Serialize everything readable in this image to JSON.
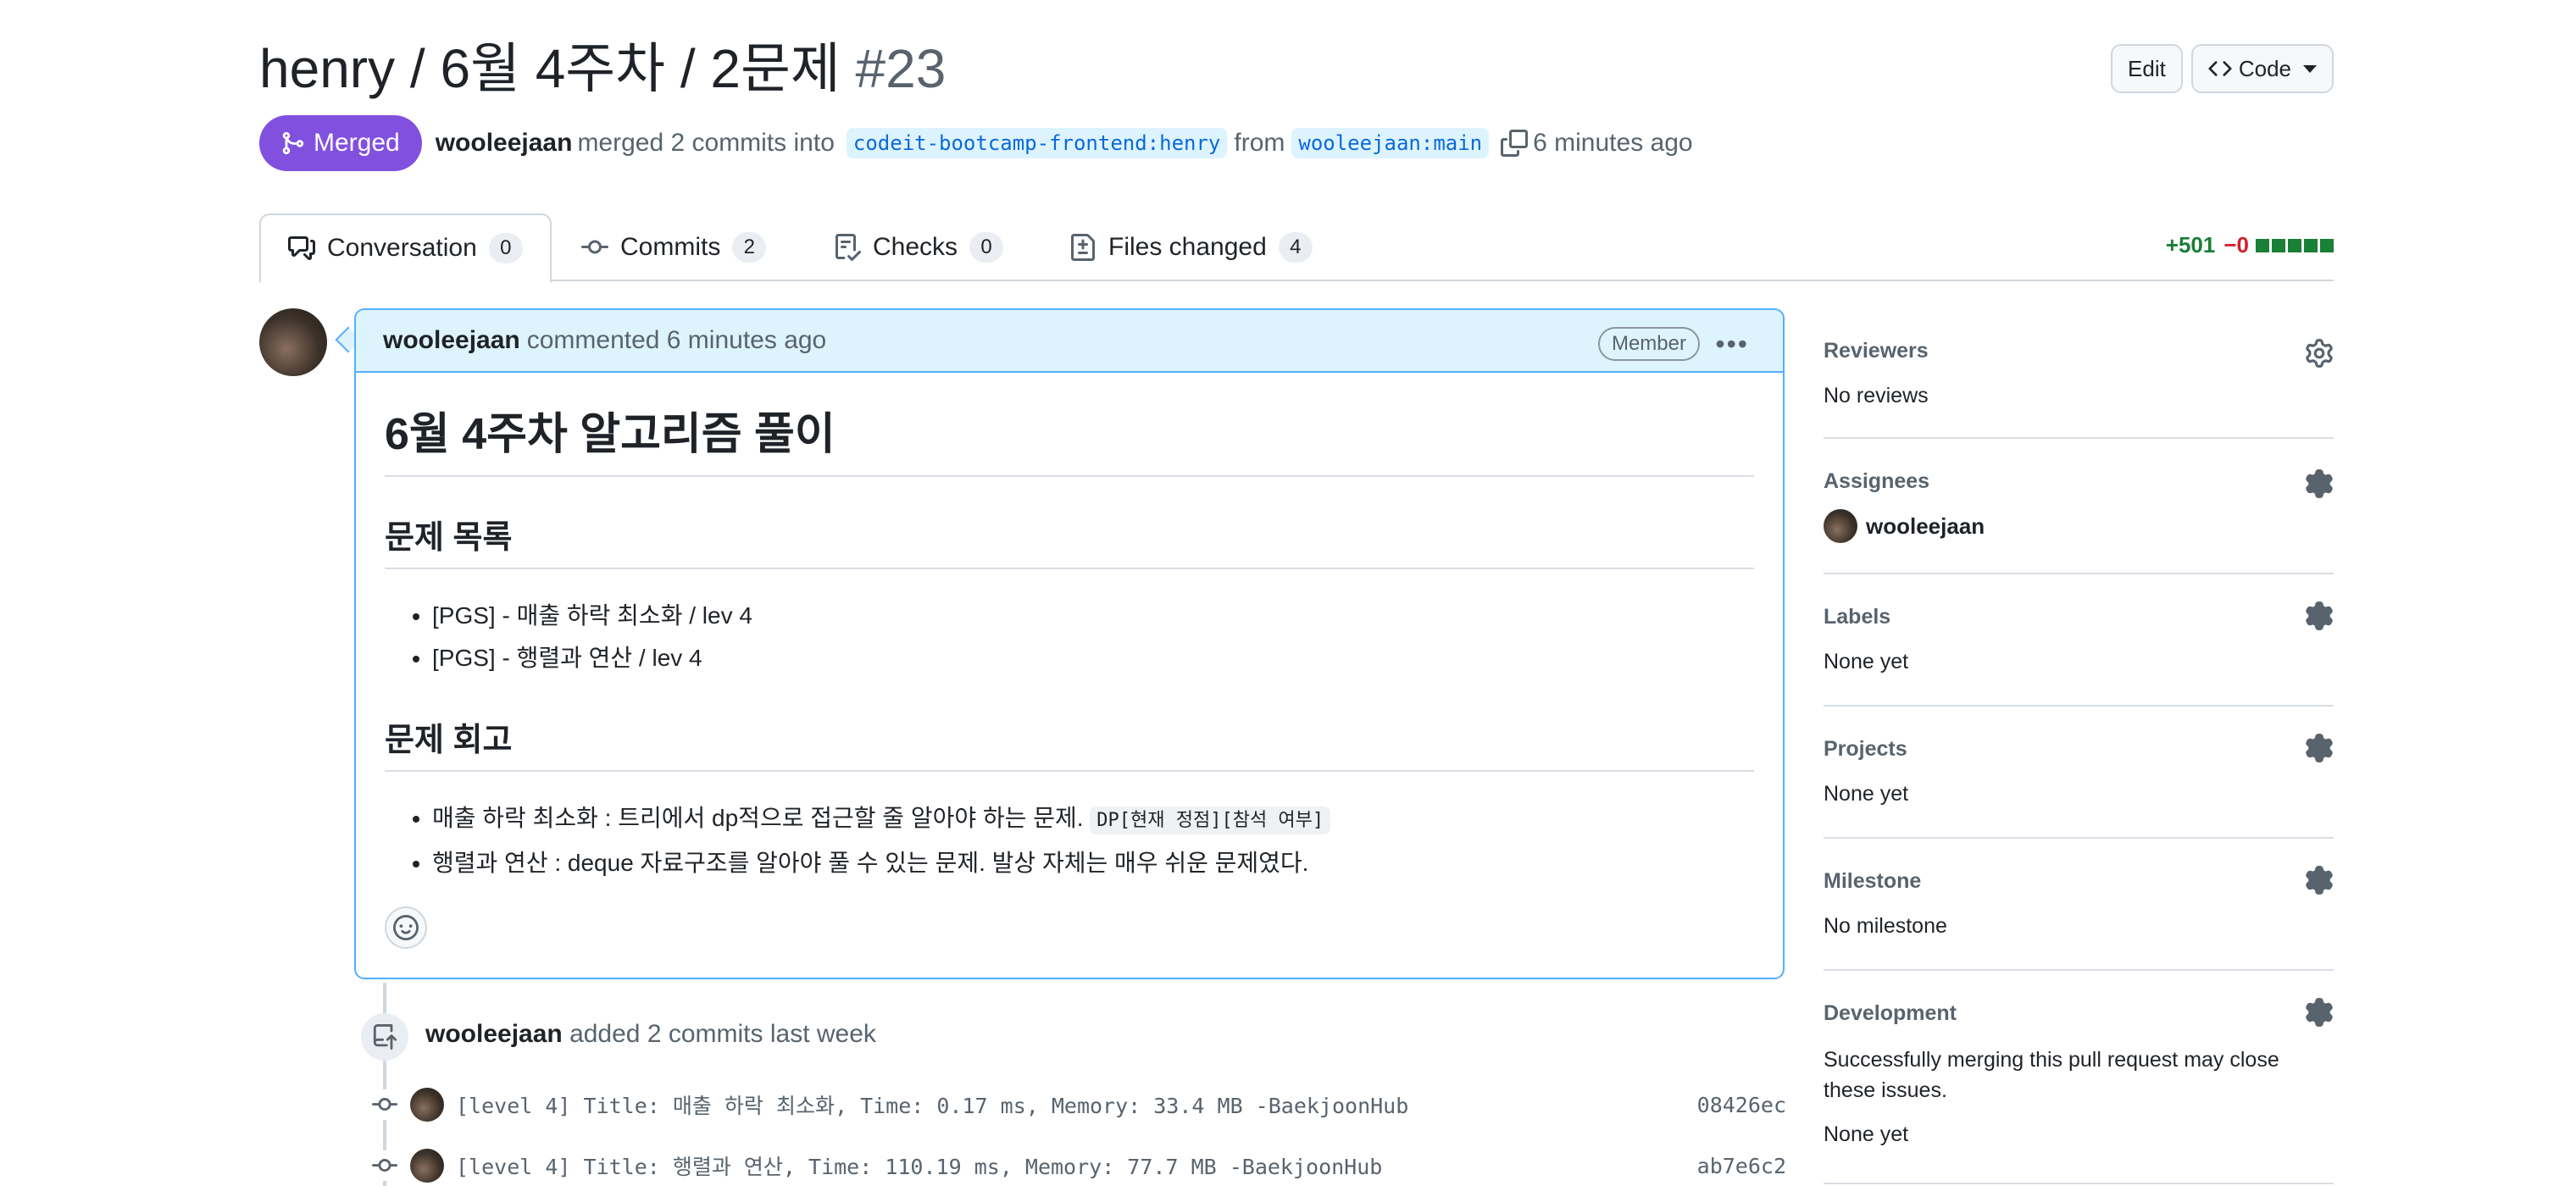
{
  "header": {
    "title": "henry / 6월 4주차 / 2문제",
    "number": "#23",
    "edit_label": "Edit",
    "code_label": "Code"
  },
  "meta": {
    "state": "Merged",
    "author": "wooleejaan",
    "action": "merged 2 commits into",
    "base_branch": "codeit-bootcamp-frontend:henry",
    "from": "from",
    "head_branch": "wooleejaan:main",
    "time": "6 minutes ago"
  },
  "tabs": [
    {
      "label": "Conversation",
      "count": "0"
    },
    {
      "label": "Commits",
      "count": "2"
    },
    {
      "label": "Checks",
      "count": "0"
    },
    {
      "label": "Files changed",
      "count": "4"
    }
  ],
  "diffstat": {
    "additions": "+501",
    "deletions": "−0"
  },
  "comment": {
    "author": "wooleejaan",
    "action": "commented 6 minutes ago",
    "badge": "Member",
    "h1": "6월 4주차 알고리즘 풀이",
    "h2_list": "문제 목록",
    "problems": [
      "[PGS] - 매출 하락 최소화 / lev 4",
      "[PGS] - 행렬과 연산 / lev 4"
    ],
    "h2_review": "문제 회고",
    "review_1": "매출 하락 최소화 : 트리에서 dp적으로 접근할 줄 알아야 하는 문제.",
    "review_1_code": "DP[현재 정점][참석 여부]",
    "review_2": "행렬과 연산 : deque 자료구조를 알아야 풀 수 있는 문제. 발상 자체는 매우 쉬운 문제였다."
  },
  "timeline": {
    "author": "wooleejaan",
    "text": "added 2 commits last week",
    "commits": [
      {
        "message": "[level 4] Title: 매출 하락 최소화, Time: 0.17 ms, Memory: 33.4 MB -BaekjoonHub",
        "sha": "08426ec"
      },
      {
        "message": "[level 4] Title: 행렬과 연산, Time: 110.19 ms, Memory: 77.7 MB -BaekjoonHub",
        "sha": "ab7e6c2"
      }
    ]
  },
  "sidebar": {
    "reviewers": {
      "title": "Reviewers",
      "value": "No reviews"
    },
    "assignees": {
      "title": "Assignees",
      "value": "wooleejaan"
    },
    "labels": {
      "title": "Labels",
      "value": "None yet"
    },
    "projects": {
      "title": "Projects",
      "value": "None yet"
    },
    "milestone": {
      "title": "Milestone",
      "value": "No milestone"
    },
    "development": {
      "title": "Development",
      "description": "Successfully merging this pull request may close these issues.",
      "value": "None yet"
    }
  }
}
